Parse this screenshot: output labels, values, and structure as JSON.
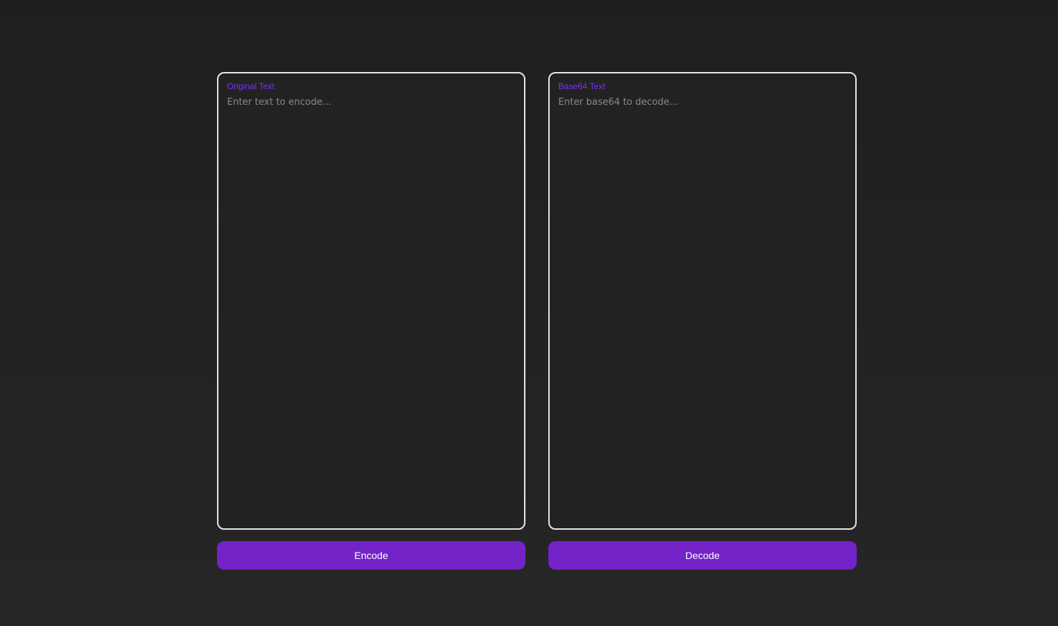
{
  "colors": {
    "accent": "#7323c8",
    "label": "#7b2ff7",
    "panel_border": "#e6e6e6",
    "background": "#1f1f1f"
  },
  "encoder": {
    "label": "Original Text",
    "placeholder": "Enter text to encode...",
    "value": ""
  },
  "decoder": {
    "label": "Base64 Text",
    "placeholder": "Enter base64 to decode...",
    "value": ""
  },
  "actions": {
    "encode_label": "Encode",
    "decode_label": "Decode"
  }
}
